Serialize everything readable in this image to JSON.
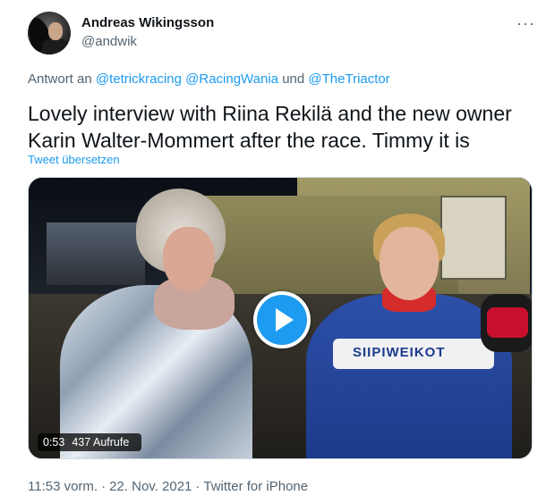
{
  "author": {
    "name": "Andreas Wikingsson",
    "handle": "@andwik",
    "avatar": "avatar-photo"
  },
  "more_menu": {
    "icon": "more-horizontal-icon",
    "label": "···"
  },
  "reply": {
    "prefix": "Antwort an ",
    "mentions": [
      "@tetrickracing",
      "@RacingWania"
    ],
    "conjunction": " und ",
    "last_mention": "@TheTriactor"
  },
  "tweet": {
    "text_line1": "Lovely interview with Riina Rekilä and the new owner",
    "text_line2": "Karin Walter-Mommert after the race. Timmy it is",
    "translate_label": "Tweet übersetzen"
  },
  "video": {
    "play_icon": "play-icon",
    "duration": "0:53",
    "views": "437 Aufrufe",
    "jacket_logo": "SIIPIWEIKOT"
  },
  "footer": {
    "time": "11:53 vorm.",
    "separator": "·",
    "date": "22. Nov. 2021",
    "source": "Twitter for iPhone"
  },
  "colors": {
    "link": "#1d9bf0",
    "secondary_text": "#536471",
    "primary_text": "#0f1419",
    "play_button": "#1d9bf0"
  }
}
